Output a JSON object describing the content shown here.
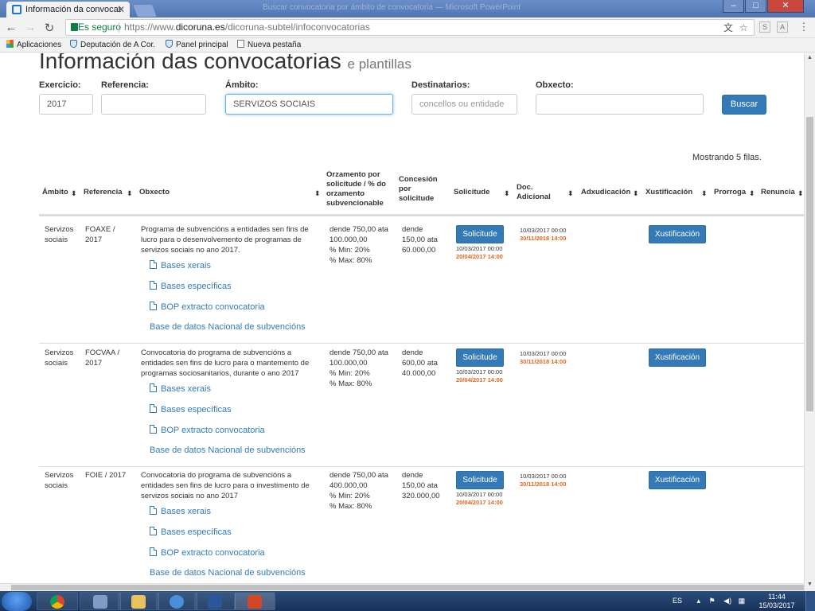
{
  "browser": {
    "tab_title": "Información da convocat",
    "window_caption": "Buscar convocatoria por ámbito de convocatoria — Microsoft PowerPoint",
    "secure_label": "Es seguro",
    "url_scheme": "https://www.",
    "url_host": "dicoruna.es",
    "url_path": "/dicoruna-subtel/infoconvocatorias",
    "bookmarks": [
      "Aplicaciones",
      "Deputación de A Cor.",
      "Panel principal",
      "Nueva pestaña"
    ]
  },
  "page": {
    "title": "Información das convocatorias",
    "subtitle": "e plantillas"
  },
  "filters": {
    "exercicio": {
      "label": "Exercicio:",
      "value": "2017"
    },
    "referencia": {
      "label": "Referencia:",
      "value": ""
    },
    "ambito": {
      "label": "Ámbito:",
      "value": "SERVIZOS SOCIAIS"
    },
    "destinatarios": {
      "label": "Destinatarios:",
      "placeholder": "concellos ou entidade"
    },
    "obxecto": {
      "label": "Obxecto:",
      "value": ""
    },
    "search_label": "Buscar"
  },
  "table": {
    "row_count_text": "Mostrando 5 filas.",
    "headers": {
      "ambito": "Ámbito",
      "referencia": "Referencia",
      "obxecto": "Obxecto",
      "orzamento": "Orzamento por solicitude / % do orzamento subvencionable",
      "concesion": "Concesión por solicitude",
      "solicitude": "Solicitude",
      "doc": "Doc. Adicional",
      "adxudicacion": "Adxudicación",
      "xustificacion": "Xustificación",
      "prorroga": "Prorroga",
      "renuncia": "Renuncia"
    },
    "rows": [
      {
        "ambito": "Servizos sociais",
        "referencia": "FOAXE / 2017",
        "obxecto": "Programa de subvencións a entidades sen fins de lucro para o desenvolvemento de programas de servizos sociais no ano 2017.",
        "links": [
          "Bases xerais",
          "Bases específicas",
          "BOP extracto convocatoria",
          "Base de datos Nacional de subvencións"
        ],
        "orzamento": "dende 750,00 ata 100.000,00\n% Min: 20%\n% Max: 80%",
        "concesion": "dende 150,00 ata 60.000,00",
        "solicitude_btn": "Solicitude",
        "sol_from": "10/03/2017 00:00",
        "sol_to": "20/04/2017 14:00",
        "doc_from": "10/03/2017 00:00",
        "doc_to": "30/11/2018 14:00",
        "xust_btn": "Xustificación"
      },
      {
        "ambito": "Servizos sociais",
        "referencia": "FOCVAA / 2017",
        "obxecto": "Convocatoria do programa de subvencións a entidades sen fins de lucro para o mantemento de programas sociosanitarios, durante o ano 2017",
        "links": [
          "Bases xerais",
          "Bases específicas",
          "BOP extracto convocatoria",
          "Base de datos Nacional de subvencións"
        ],
        "orzamento": "dende 750,00 ata 100.000,00\n% Min: 20%\n% Max: 80%",
        "concesion": "dende 600,00 ata 40.000,00",
        "solicitude_btn": "Solicitude",
        "sol_from": "10/03/2017 00:00",
        "sol_to": "20/04/2017 14:00",
        "doc_from": "10/03/2017 00:00",
        "doc_to": "30/11/2018 14:00",
        "xust_btn": "Xustificación"
      },
      {
        "ambito": "Servizos sociais",
        "referencia": "FOIE / 2017",
        "obxecto": "Convocatoria do programa de subvencións a entidades sen fins de lucro para o investimento de servizos sociais no ano 2017",
        "links": [
          "Bases xerais",
          "Bases específicas",
          "BOP extracto convocatoria",
          "Base de datos Nacional de subvencións"
        ],
        "orzamento": "dende 750,00 ata 400.000,00\n% Min: 20%\n% Max: 80%",
        "concesion": "dende 150,00 ata 320.000,00",
        "solicitude_btn": "Solicitude",
        "sol_from": "10/03/2017 00:00",
        "sol_to": "20/04/2017 14:00",
        "doc_from": "10/03/2017 00:00",
        "doc_to": "30/11/2018 14:00",
        "xust_btn": "Xustificación"
      }
    ]
  },
  "taskbar": {
    "language": "ES",
    "time": "11:44",
    "date": "15/03/2017"
  }
}
